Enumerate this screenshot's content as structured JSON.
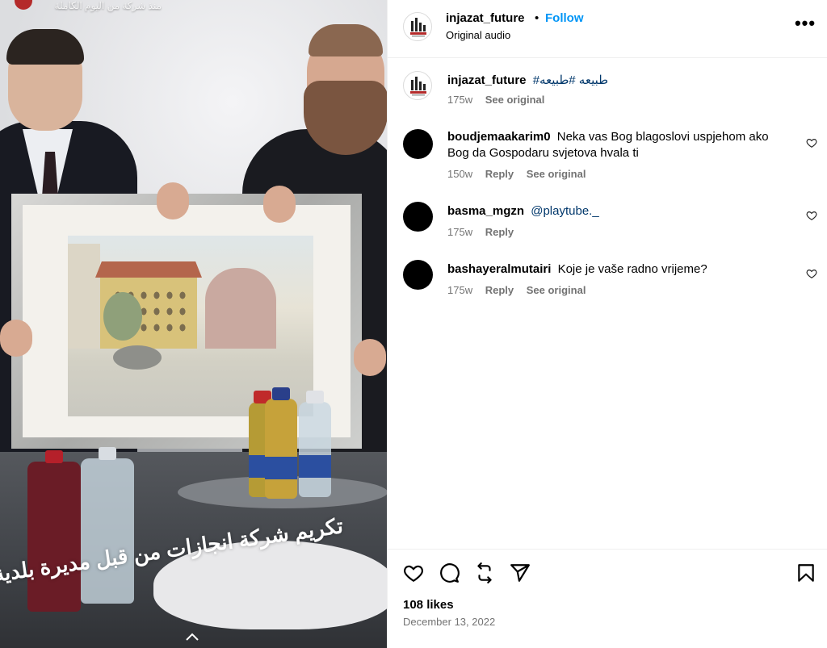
{
  "media": {
    "top_overlay_text": "منذ شركة من اليوم الكاملة",
    "caption_text": "تكريم شركة انجازات من قبل مديرة بلدية فيسكوء"
  },
  "post": {
    "author": "injazat_future",
    "separator": "•",
    "follow_label": "Follow",
    "audio_label": "Original audio",
    "more_label": "•••",
    "caption": {
      "username": "injazat_future",
      "text": "#طبيعه #طبيعه",
      "time": "175w",
      "see_original": "See original"
    }
  },
  "comments": [
    {
      "username": "boudjemaakarim0",
      "text": "Neka vas Bog blagoslovi uspjehom ako Bog da Gospodaru svjetova hvala ti",
      "time": "150w",
      "reply": "Reply",
      "see_original": "See original"
    },
    {
      "username": "basma_mgzn",
      "text": "@playtube._",
      "time": "175w",
      "reply": "Reply",
      "see_original": ""
    },
    {
      "username": "bashayeralmutairi",
      "text": "Koje je vaše radno vrijeme?",
      "time": "175w",
      "reply": "Reply",
      "see_original": "See original"
    }
  ],
  "actions": {
    "icons": [
      "heart-icon",
      "comment-icon",
      "repost-icon",
      "share-icon",
      "bookmark-icon"
    ],
    "likes": "108 likes",
    "date": "December 13, 2022"
  },
  "colors": {
    "follow": "#0095f6",
    "link": "#00376b",
    "meta": "#737373",
    "logo_red": "#b42a2a"
  }
}
